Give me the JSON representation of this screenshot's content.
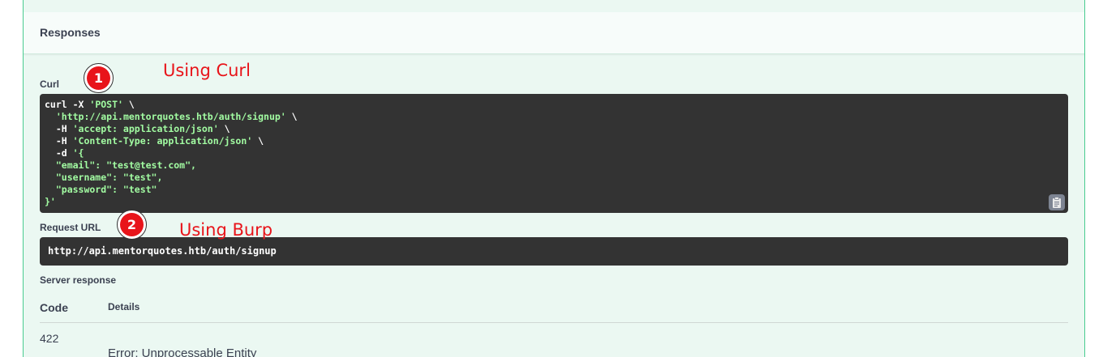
{
  "responses_title": "Responses",
  "curl": {
    "label": "Curl",
    "lines": [
      [
        {
          "t": "curl -X ",
          "s": false
        },
        {
          "t": "'POST'",
          "s": true
        },
        {
          "t": " \\",
          "s": false
        }
      ],
      [
        {
          "t": "  ",
          "s": false
        },
        {
          "t": "'http://api.mentorquotes.htb/auth/signup'",
          "s": true
        },
        {
          "t": " \\",
          "s": false
        }
      ],
      [
        {
          "t": "  -H ",
          "s": false
        },
        {
          "t": "'accept: application/json'",
          "s": true
        },
        {
          "t": " \\",
          "s": false
        }
      ],
      [
        {
          "t": "  -H ",
          "s": false
        },
        {
          "t": "'Content-Type: application/json'",
          "s": true
        },
        {
          "t": " \\",
          "s": false
        }
      ],
      [
        {
          "t": "  -d ",
          "s": false
        },
        {
          "t": "'{",
          "s": true
        }
      ],
      [
        {
          "t": "  \"email\": \"test@test.com\",",
          "s": true
        }
      ],
      [
        {
          "t": "  \"username\": \"test\",",
          "s": true
        }
      ],
      [
        {
          "t": "  \"password\": \"test\"",
          "s": true
        }
      ],
      [
        {
          "t": "}'",
          "s": true
        }
      ]
    ]
  },
  "request_url": {
    "label": "Request URL",
    "value": "http://api.mentorquotes.htb/auth/signup"
  },
  "server_response": {
    "label": "Server response",
    "col_code": "Code",
    "col_details": "Details",
    "code": "422",
    "details": "Error: Unprocessable Entity"
  },
  "annotations": {
    "one": {
      "number": "1",
      "text": "Using Curl"
    },
    "two": {
      "number": "2",
      "text": "Using Burp"
    }
  },
  "icons": {
    "copy": "clipboard-icon"
  },
  "colors": {
    "accent": "#49cc90",
    "annotation": "#e8141a",
    "code_bg": "#333333",
    "string": "#a2fca2"
  }
}
